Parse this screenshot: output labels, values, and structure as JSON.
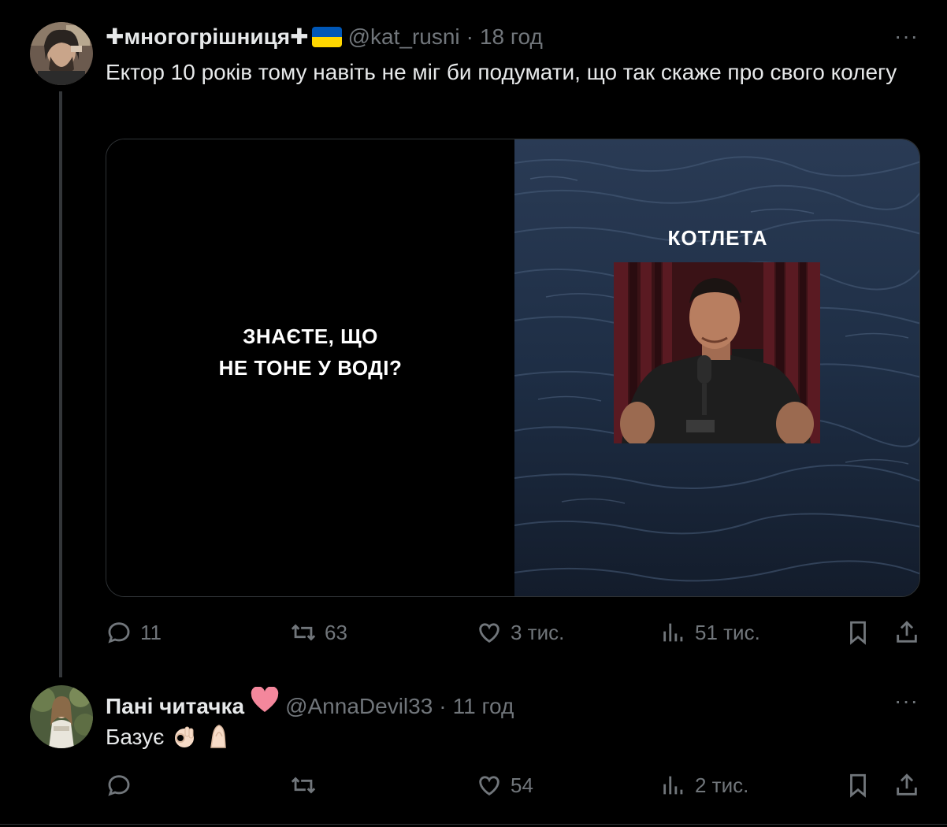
{
  "tweet1": {
    "name": "✚многогрішниця✚",
    "handle": "@kat_rusni",
    "dot": "·",
    "time": "18 год",
    "more": "···",
    "text": "Ектор 10 років тому навіть не міг би подумати, що так скаже про свого колегу",
    "media": {
      "left_line1": "ЗНАЄТЕ, ЩО",
      "left_line2": "НЕ ТОНЕ У ВОДІ?",
      "right_title": "КОТЛЕТА"
    },
    "actions": {
      "replies": "11",
      "reposts": "63",
      "likes": "3 тис.",
      "views": "51 тис."
    }
  },
  "tweet2": {
    "name": "Пані читачка",
    "handle": "@AnnaDevil33",
    "dot": "·",
    "time": "11 год",
    "more": "···",
    "text": "Базує",
    "actions": {
      "replies": "",
      "reposts": "",
      "likes": "54",
      "views": "2 тис."
    }
  },
  "colors": {
    "background": "#000000",
    "text_primary": "#e7e9ea",
    "text_secondary": "#71767b",
    "border": "#2f3336",
    "heart": "#f4879c",
    "flag_blue": "#0057b7",
    "flag_yellow": "#ffd700"
  },
  "icons": [
    "reply-icon",
    "repost-icon",
    "like-icon",
    "views-icon",
    "bookmark-icon",
    "share-icon",
    "more-icon"
  ]
}
